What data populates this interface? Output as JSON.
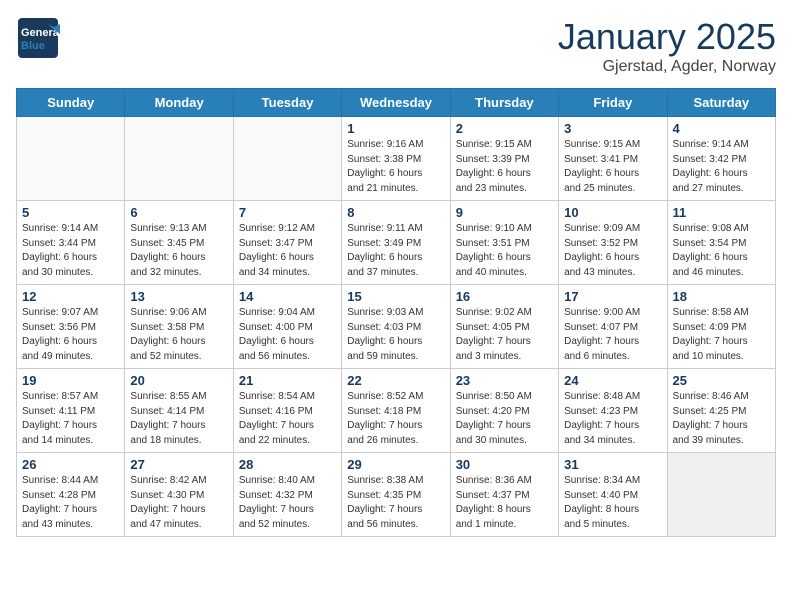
{
  "header": {
    "logo_general": "General",
    "logo_blue": "Blue",
    "month_title": "January 2025",
    "location": "Gjerstad, Agder, Norway"
  },
  "days_of_week": [
    "Sunday",
    "Monday",
    "Tuesday",
    "Wednesday",
    "Thursday",
    "Friday",
    "Saturday"
  ],
  "weeks": [
    [
      {
        "day": "",
        "info": ""
      },
      {
        "day": "",
        "info": ""
      },
      {
        "day": "",
        "info": ""
      },
      {
        "day": "1",
        "info": "Sunrise: 9:16 AM\nSunset: 3:38 PM\nDaylight: 6 hours\nand 21 minutes."
      },
      {
        "day": "2",
        "info": "Sunrise: 9:15 AM\nSunset: 3:39 PM\nDaylight: 6 hours\nand 23 minutes."
      },
      {
        "day": "3",
        "info": "Sunrise: 9:15 AM\nSunset: 3:41 PM\nDaylight: 6 hours\nand 25 minutes."
      },
      {
        "day": "4",
        "info": "Sunrise: 9:14 AM\nSunset: 3:42 PM\nDaylight: 6 hours\nand 27 minutes."
      }
    ],
    [
      {
        "day": "5",
        "info": "Sunrise: 9:14 AM\nSunset: 3:44 PM\nDaylight: 6 hours\nand 30 minutes."
      },
      {
        "day": "6",
        "info": "Sunrise: 9:13 AM\nSunset: 3:45 PM\nDaylight: 6 hours\nand 32 minutes."
      },
      {
        "day": "7",
        "info": "Sunrise: 9:12 AM\nSunset: 3:47 PM\nDaylight: 6 hours\nand 34 minutes."
      },
      {
        "day": "8",
        "info": "Sunrise: 9:11 AM\nSunset: 3:49 PM\nDaylight: 6 hours\nand 37 minutes."
      },
      {
        "day": "9",
        "info": "Sunrise: 9:10 AM\nSunset: 3:51 PM\nDaylight: 6 hours\nand 40 minutes."
      },
      {
        "day": "10",
        "info": "Sunrise: 9:09 AM\nSunset: 3:52 PM\nDaylight: 6 hours\nand 43 minutes."
      },
      {
        "day": "11",
        "info": "Sunrise: 9:08 AM\nSunset: 3:54 PM\nDaylight: 6 hours\nand 46 minutes."
      }
    ],
    [
      {
        "day": "12",
        "info": "Sunrise: 9:07 AM\nSunset: 3:56 PM\nDaylight: 6 hours\nand 49 minutes."
      },
      {
        "day": "13",
        "info": "Sunrise: 9:06 AM\nSunset: 3:58 PM\nDaylight: 6 hours\nand 52 minutes."
      },
      {
        "day": "14",
        "info": "Sunrise: 9:04 AM\nSunset: 4:00 PM\nDaylight: 6 hours\nand 56 minutes."
      },
      {
        "day": "15",
        "info": "Sunrise: 9:03 AM\nSunset: 4:03 PM\nDaylight: 6 hours\nand 59 minutes."
      },
      {
        "day": "16",
        "info": "Sunrise: 9:02 AM\nSunset: 4:05 PM\nDaylight: 7 hours\nand 3 minutes."
      },
      {
        "day": "17",
        "info": "Sunrise: 9:00 AM\nSunset: 4:07 PM\nDaylight: 7 hours\nand 6 minutes."
      },
      {
        "day": "18",
        "info": "Sunrise: 8:58 AM\nSunset: 4:09 PM\nDaylight: 7 hours\nand 10 minutes."
      }
    ],
    [
      {
        "day": "19",
        "info": "Sunrise: 8:57 AM\nSunset: 4:11 PM\nDaylight: 7 hours\nand 14 minutes."
      },
      {
        "day": "20",
        "info": "Sunrise: 8:55 AM\nSunset: 4:14 PM\nDaylight: 7 hours\nand 18 minutes."
      },
      {
        "day": "21",
        "info": "Sunrise: 8:54 AM\nSunset: 4:16 PM\nDaylight: 7 hours\nand 22 minutes."
      },
      {
        "day": "22",
        "info": "Sunrise: 8:52 AM\nSunset: 4:18 PM\nDaylight: 7 hours\nand 26 minutes."
      },
      {
        "day": "23",
        "info": "Sunrise: 8:50 AM\nSunset: 4:20 PM\nDaylight: 7 hours\nand 30 minutes."
      },
      {
        "day": "24",
        "info": "Sunrise: 8:48 AM\nSunset: 4:23 PM\nDaylight: 7 hours\nand 34 minutes."
      },
      {
        "day": "25",
        "info": "Sunrise: 8:46 AM\nSunset: 4:25 PM\nDaylight: 7 hours\nand 39 minutes."
      }
    ],
    [
      {
        "day": "26",
        "info": "Sunrise: 8:44 AM\nSunset: 4:28 PM\nDaylight: 7 hours\nand 43 minutes."
      },
      {
        "day": "27",
        "info": "Sunrise: 8:42 AM\nSunset: 4:30 PM\nDaylight: 7 hours\nand 47 minutes."
      },
      {
        "day": "28",
        "info": "Sunrise: 8:40 AM\nSunset: 4:32 PM\nDaylight: 7 hours\nand 52 minutes."
      },
      {
        "day": "29",
        "info": "Sunrise: 8:38 AM\nSunset: 4:35 PM\nDaylight: 7 hours\nand 56 minutes."
      },
      {
        "day": "30",
        "info": "Sunrise: 8:36 AM\nSunset: 4:37 PM\nDaylight: 8 hours\nand 1 minute."
      },
      {
        "day": "31",
        "info": "Sunrise: 8:34 AM\nSunset: 4:40 PM\nDaylight: 8 hours\nand 5 minutes."
      },
      {
        "day": "",
        "info": ""
      }
    ]
  ]
}
